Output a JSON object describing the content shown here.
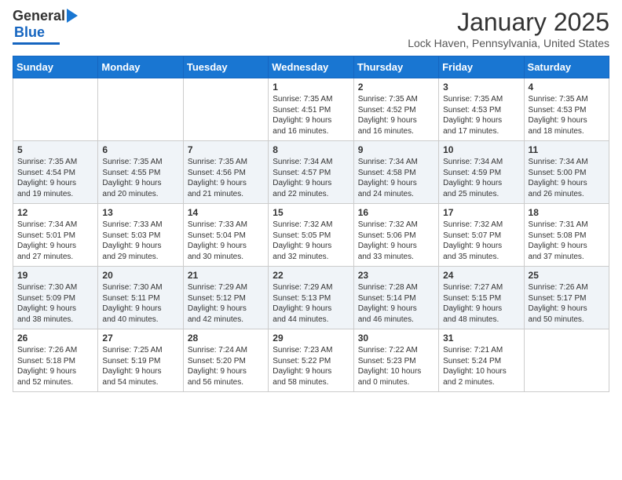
{
  "logo": {
    "general": "General",
    "blue": "Blue"
  },
  "header": {
    "month": "January 2025",
    "location": "Lock Haven, Pennsylvania, United States"
  },
  "weekdays": [
    "Sunday",
    "Monday",
    "Tuesday",
    "Wednesday",
    "Thursday",
    "Friday",
    "Saturday"
  ],
  "weeks": [
    [
      {
        "day": "",
        "content": ""
      },
      {
        "day": "",
        "content": ""
      },
      {
        "day": "",
        "content": ""
      },
      {
        "day": "1",
        "content": "Sunrise: 7:35 AM\nSunset: 4:51 PM\nDaylight: 9 hours\nand 16 minutes."
      },
      {
        "day": "2",
        "content": "Sunrise: 7:35 AM\nSunset: 4:52 PM\nDaylight: 9 hours\nand 16 minutes."
      },
      {
        "day": "3",
        "content": "Sunrise: 7:35 AM\nSunset: 4:53 PM\nDaylight: 9 hours\nand 17 minutes."
      },
      {
        "day": "4",
        "content": "Sunrise: 7:35 AM\nSunset: 4:53 PM\nDaylight: 9 hours\nand 18 minutes."
      }
    ],
    [
      {
        "day": "5",
        "content": "Sunrise: 7:35 AM\nSunset: 4:54 PM\nDaylight: 9 hours\nand 19 minutes."
      },
      {
        "day": "6",
        "content": "Sunrise: 7:35 AM\nSunset: 4:55 PM\nDaylight: 9 hours\nand 20 minutes."
      },
      {
        "day": "7",
        "content": "Sunrise: 7:35 AM\nSunset: 4:56 PM\nDaylight: 9 hours\nand 21 minutes."
      },
      {
        "day": "8",
        "content": "Sunrise: 7:34 AM\nSunset: 4:57 PM\nDaylight: 9 hours\nand 22 minutes."
      },
      {
        "day": "9",
        "content": "Sunrise: 7:34 AM\nSunset: 4:58 PM\nDaylight: 9 hours\nand 24 minutes."
      },
      {
        "day": "10",
        "content": "Sunrise: 7:34 AM\nSunset: 4:59 PM\nDaylight: 9 hours\nand 25 minutes."
      },
      {
        "day": "11",
        "content": "Sunrise: 7:34 AM\nSunset: 5:00 PM\nDaylight: 9 hours\nand 26 minutes."
      }
    ],
    [
      {
        "day": "12",
        "content": "Sunrise: 7:34 AM\nSunset: 5:01 PM\nDaylight: 9 hours\nand 27 minutes."
      },
      {
        "day": "13",
        "content": "Sunrise: 7:33 AM\nSunset: 5:03 PM\nDaylight: 9 hours\nand 29 minutes."
      },
      {
        "day": "14",
        "content": "Sunrise: 7:33 AM\nSunset: 5:04 PM\nDaylight: 9 hours\nand 30 minutes."
      },
      {
        "day": "15",
        "content": "Sunrise: 7:32 AM\nSunset: 5:05 PM\nDaylight: 9 hours\nand 32 minutes."
      },
      {
        "day": "16",
        "content": "Sunrise: 7:32 AM\nSunset: 5:06 PM\nDaylight: 9 hours\nand 33 minutes."
      },
      {
        "day": "17",
        "content": "Sunrise: 7:32 AM\nSunset: 5:07 PM\nDaylight: 9 hours\nand 35 minutes."
      },
      {
        "day": "18",
        "content": "Sunrise: 7:31 AM\nSunset: 5:08 PM\nDaylight: 9 hours\nand 37 minutes."
      }
    ],
    [
      {
        "day": "19",
        "content": "Sunrise: 7:30 AM\nSunset: 5:09 PM\nDaylight: 9 hours\nand 38 minutes."
      },
      {
        "day": "20",
        "content": "Sunrise: 7:30 AM\nSunset: 5:11 PM\nDaylight: 9 hours\nand 40 minutes."
      },
      {
        "day": "21",
        "content": "Sunrise: 7:29 AM\nSunset: 5:12 PM\nDaylight: 9 hours\nand 42 minutes."
      },
      {
        "day": "22",
        "content": "Sunrise: 7:29 AM\nSunset: 5:13 PM\nDaylight: 9 hours\nand 44 minutes."
      },
      {
        "day": "23",
        "content": "Sunrise: 7:28 AM\nSunset: 5:14 PM\nDaylight: 9 hours\nand 46 minutes."
      },
      {
        "day": "24",
        "content": "Sunrise: 7:27 AM\nSunset: 5:15 PM\nDaylight: 9 hours\nand 48 minutes."
      },
      {
        "day": "25",
        "content": "Sunrise: 7:26 AM\nSunset: 5:17 PM\nDaylight: 9 hours\nand 50 minutes."
      }
    ],
    [
      {
        "day": "26",
        "content": "Sunrise: 7:26 AM\nSunset: 5:18 PM\nDaylight: 9 hours\nand 52 minutes."
      },
      {
        "day": "27",
        "content": "Sunrise: 7:25 AM\nSunset: 5:19 PM\nDaylight: 9 hours\nand 54 minutes."
      },
      {
        "day": "28",
        "content": "Sunrise: 7:24 AM\nSunset: 5:20 PM\nDaylight: 9 hours\nand 56 minutes."
      },
      {
        "day": "29",
        "content": "Sunrise: 7:23 AM\nSunset: 5:22 PM\nDaylight: 9 hours\nand 58 minutes."
      },
      {
        "day": "30",
        "content": "Sunrise: 7:22 AM\nSunset: 5:23 PM\nDaylight: 10 hours\nand 0 minutes."
      },
      {
        "day": "31",
        "content": "Sunrise: 7:21 AM\nSunset: 5:24 PM\nDaylight: 10 hours\nand 2 minutes."
      },
      {
        "day": "",
        "content": ""
      }
    ]
  ]
}
